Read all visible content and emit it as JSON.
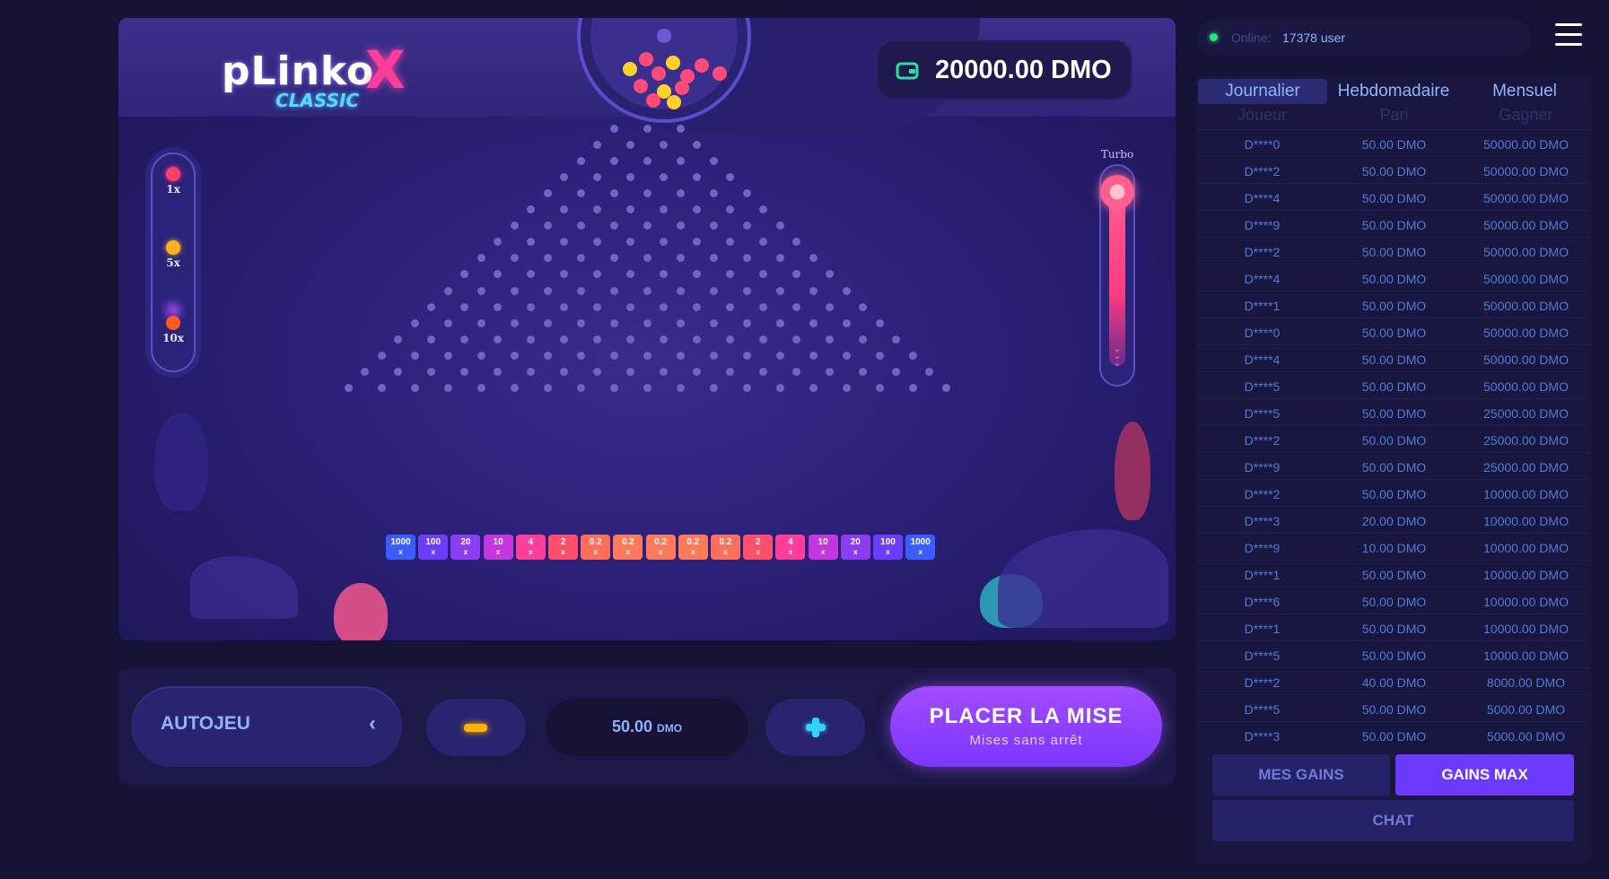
{
  "game": {
    "logo": {
      "text": "pLinko",
      "x": "X",
      "sub": "CLASSIC"
    },
    "balance": "20000.00 DMO",
    "risk_levels": [
      {
        "label": "1x",
        "color": "#ff3d6e"
      },
      {
        "label": "5x",
        "color": "#ffb020"
      },
      {
        "label": "10x",
        "color": "#ff5a1f"
      }
    ],
    "turbo_label": "Turbo",
    "slots": [
      {
        "v": "1000",
        "c": "#3b5cff"
      },
      {
        "v": "100",
        "c": "#6a3dff"
      },
      {
        "v": "20",
        "c": "#8a3df2"
      },
      {
        "v": "10",
        "c": "#c437e0"
      },
      {
        "v": "4",
        "c": "#ff3d9a"
      },
      {
        "v": "2",
        "c": "#ff4f6a"
      },
      {
        "v": "0.2",
        "c": "#ff6f5a"
      },
      {
        "v": "0.2",
        "c": "#ff7a5a"
      },
      {
        "v": "0.2",
        "c": "#ff7a5a"
      },
      {
        "v": "0.2",
        "c": "#ff7a5a"
      },
      {
        "v": "0.2",
        "c": "#ff6f5a"
      },
      {
        "v": "2",
        "c": "#ff4f6a"
      },
      {
        "v": "4",
        "c": "#ff3d9a"
      },
      {
        "v": "10",
        "c": "#c437e0"
      },
      {
        "v": "20",
        "c": "#8a3df2"
      },
      {
        "v": "100",
        "c": "#6a3dff"
      },
      {
        "v": "1000",
        "c": "#3b5cff"
      }
    ],
    "slot_unit": "x"
  },
  "controls": {
    "autoplay": "AUTOJEU",
    "bet_value": "50.00",
    "bet_unit": "DMO",
    "place_bet": "PLACER LA MISE",
    "place_bet_sub": "Mises sans arrêt"
  },
  "sidebar": {
    "online_label": "Online:",
    "online_count": "17378 user",
    "tabs": [
      "Journalier",
      "Hebdomadaire",
      "Mensuel"
    ],
    "columns": [
      "Joueur",
      "Pari",
      "Gagner"
    ],
    "rows": [
      [
        "D****0",
        "50.00 DMO",
        "50000.00 DMO"
      ],
      [
        "D****2",
        "50.00 DMO",
        "50000.00 DMO"
      ],
      [
        "D****4",
        "50.00 DMO",
        "50000.00 DMO"
      ],
      [
        "D****9",
        "50.00 DMO",
        "50000.00 DMO"
      ],
      [
        "D****2",
        "50.00 DMO",
        "50000.00 DMO"
      ],
      [
        "D****4",
        "50.00 DMO",
        "50000.00 DMO"
      ],
      [
        "D****1",
        "50.00 DMO",
        "50000.00 DMO"
      ],
      [
        "D****0",
        "50.00 DMO",
        "50000.00 DMO"
      ],
      [
        "D****4",
        "50.00 DMO",
        "50000.00 DMO"
      ],
      [
        "D****5",
        "50.00 DMO",
        "50000.00 DMO"
      ],
      [
        "D****5",
        "50.00 DMO",
        "25000.00 DMO"
      ],
      [
        "D****2",
        "50.00 DMO",
        "25000.00 DMO"
      ],
      [
        "D****9",
        "50.00 DMO",
        "25000.00 DMO"
      ],
      [
        "D****2",
        "50.00 DMO",
        "10000.00 DMO"
      ],
      [
        "D****3",
        "20.00 DMO",
        "10000.00 DMO"
      ],
      [
        "D****9",
        "10.00 DMO",
        "10000.00 DMO"
      ],
      [
        "D****1",
        "50.00 DMO",
        "10000.00 DMO"
      ],
      [
        "D****6",
        "50.00 DMO",
        "10000.00 DMO"
      ],
      [
        "D****1",
        "50.00 DMO",
        "10000.00 DMO"
      ],
      [
        "D****5",
        "50.00 DMO",
        "10000.00 DMO"
      ],
      [
        "D****2",
        "40.00 DMO",
        "8000.00 DMO"
      ],
      [
        "D****5",
        "50.00 DMO",
        "5000.00 DMO"
      ],
      [
        "D****3",
        "50.00 DMO",
        "5000.00 DMO"
      ]
    ],
    "my_gains": "MES GAINS",
    "max_gains": "GAINS MAX",
    "chat": "CHAT"
  }
}
